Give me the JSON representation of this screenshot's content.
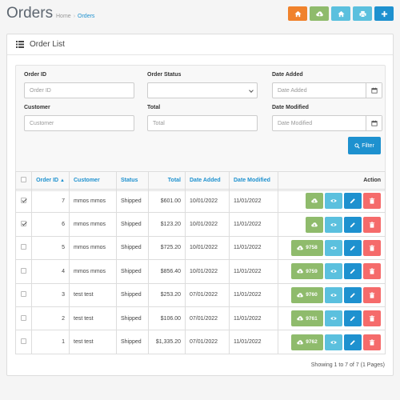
{
  "header": {
    "title": "Orders",
    "breadcrumb": [
      {
        "label": "Home",
        "active": false
      },
      {
        "label": "Orders",
        "active": true
      }
    ],
    "buttons": [
      {
        "icon": "home-icon",
        "color": "#f0822c"
      },
      {
        "icon": "cloud-download-icon",
        "color": "#8fbb6c"
      },
      {
        "icon": "home-icon",
        "color": "#5bc0de"
      },
      {
        "icon": "print-icon",
        "color": "#5bc0de"
      },
      {
        "icon": "plus-icon",
        "color": "#1e91cf"
      }
    ]
  },
  "panel": {
    "title": "Order List"
  },
  "filter": {
    "order_id": {
      "label": "Order ID",
      "placeholder": "Order ID",
      "value": ""
    },
    "order_status": {
      "label": "Order Status",
      "value": ""
    },
    "date_added": {
      "label": "Date Added",
      "placeholder": "Date Added",
      "value": ""
    },
    "customer": {
      "label": "Customer",
      "placeholder": "Customer",
      "value": ""
    },
    "total": {
      "label": "Total",
      "placeholder": "Total",
      "value": ""
    },
    "date_modified": {
      "label": "Date Modified",
      "placeholder": "Date Modified",
      "value": ""
    },
    "button_label": "Filter"
  },
  "table": {
    "headers": {
      "order_id": "Order ID",
      "customer": "Customer",
      "status": "Status",
      "total": "Total",
      "date_added": "Date Added",
      "date_modified": "Date Modified",
      "action": "Action"
    },
    "rows": [
      {
        "checked": true,
        "id": "7",
        "customer": "mmos mmos",
        "status": "Shipped",
        "total": "$601.00",
        "date_added": "10/01/2022",
        "date_modified": "11/01/2022",
        "invoice": ""
      },
      {
        "checked": true,
        "id": "6",
        "customer": "mmos mmos",
        "status": "Shipped",
        "total": "$123.20",
        "date_added": "10/01/2022",
        "date_modified": "11/01/2022",
        "invoice": ""
      },
      {
        "checked": false,
        "id": "5",
        "customer": "mmos mmos",
        "status": "Shipped",
        "total": "$725.20",
        "date_added": "10/01/2022",
        "date_modified": "11/01/2022",
        "invoice": "9758"
      },
      {
        "checked": false,
        "id": "4",
        "customer": "mmos mmos",
        "status": "Shipped",
        "total": "$856.40",
        "date_added": "10/01/2022",
        "date_modified": "11/01/2022",
        "invoice": "9759"
      },
      {
        "checked": false,
        "id": "3",
        "customer": "test test",
        "status": "Shipped",
        "total": "$253.20",
        "date_added": "07/01/2022",
        "date_modified": "11/01/2022",
        "invoice": "9760"
      },
      {
        "checked": false,
        "id": "2",
        "customer": "test test",
        "status": "Shipped",
        "total": "$106.00",
        "date_added": "07/01/2022",
        "date_modified": "11/01/2022",
        "invoice": "9761"
      },
      {
        "checked": false,
        "id": "1",
        "customer": "test test",
        "status": "Shipped",
        "total": "$1,335.20",
        "date_added": "07/01/2022",
        "date_modified": "11/01/2022",
        "invoice": "9762"
      }
    ]
  },
  "pagination": {
    "text": "Showing 1 to 7 of 7 (1 Pages)"
  },
  "colors": {
    "primary": "#1e91cf",
    "success": "#8fbb6c",
    "info": "#5bc0de",
    "danger": "#f56b6b",
    "warning": "#f0822c"
  }
}
